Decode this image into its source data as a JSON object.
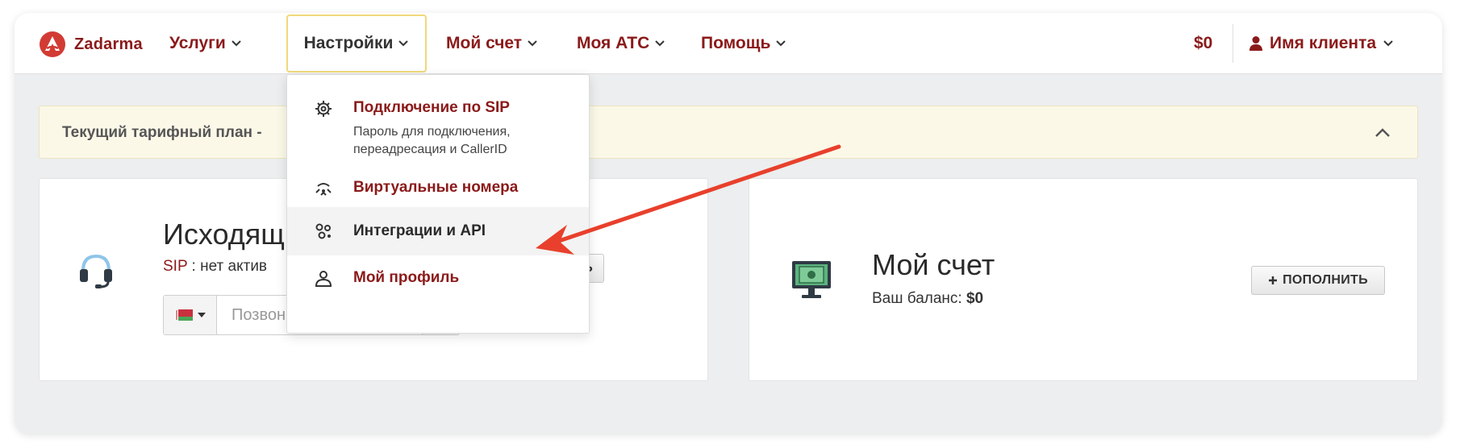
{
  "brand": {
    "name": "Zadarma",
    "color": "#8b1a1a"
  },
  "nav": {
    "items": [
      {
        "label": "Услуги"
      },
      {
        "label": "Настройки"
      },
      {
        "label": "Мой счет"
      },
      {
        "label": "Моя АТС"
      },
      {
        "label": "Помощь"
      }
    ],
    "balance": "$0",
    "user": "Имя клиента"
  },
  "tariff": {
    "text": "Текущий тарифный план -"
  },
  "dropdown": {
    "items": [
      {
        "label": "Подключение по SIP",
        "desc": "Пароль для подключения, переадресация и CallerID",
        "icon": "gear-icon"
      },
      {
        "label": "Виртуальные номера",
        "icon": "antenna-icon"
      },
      {
        "label": "Интеграции и API",
        "icon": "integrations-icon"
      },
      {
        "label": "Мой профиль",
        "icon": "profile-icon"
      }
    ]
  },
  "outgoing": {
    "title": "Исходящ",
    "sip_label": "SIP",
    "sip_status": " : нет актив",
    "configure_button": "АСТРОИТЬ",
    "phone_placeholder": "Позвонить с сайта:"
  },
  "account": {
    "title": "Мой счет",
    "balance_label": "Ваш баланс: ",
    "balance_value": "$0",
    "topup_button": "ПОПОЛНИТЬ"
  },
  "colors": {
    "accent": "#8b1a1a",
    "arrow": "#e8402c",
    "tariff_bg": "#fbf8e8",
    "active_border": "#f0d97a"
  }
}
